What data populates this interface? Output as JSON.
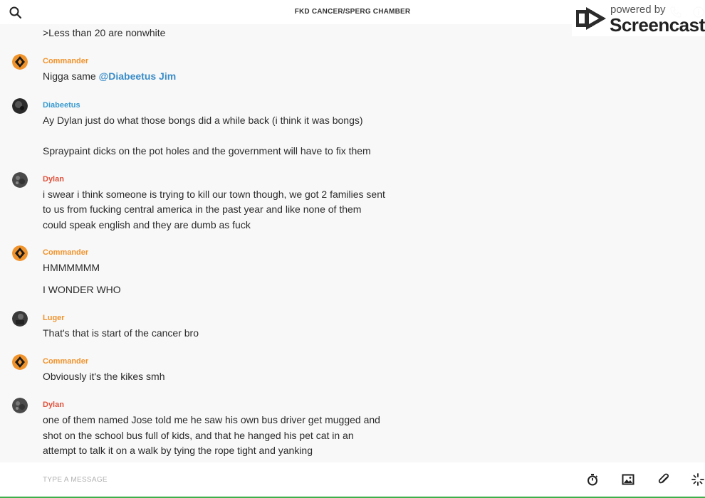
{
  "header": {
    "title": "FKD CANCER/SPERG CHAMBER",
    "search_icon": "search-icon",
    "right_icons": [
      "phone-icon",
      "info-icon"
    ]
  },
  "watermark": {
    "powered_by": "powered by",
    "brand": "Screencastify"
  },
  "colors": {
    "commander": "#f0932b",
    "diabeetus": "#3a9bd0",
    "dylan": "#e0523c",
    "luger": "#f0932b",
    "mention": "#3a8cc8",
    "composer_bar": "#3db04c"
  },
  "messages": [
    {
      "author": "",
      "lines": [
        ">Less than 20 are nonwhite"
      ]
    },
    {
      "author": "Commander",
      "lines": [
        "Nigga same "
      ],
      "mention": "@Diabeetus Jim"
    },
    {
      "author": "Diabeetus",
      "lines": [
        "Ay Dylan just do what those bongs did a while back (i think it was bongs)",
        "Spraypaint dicks on the pot holes and the government will have to fix them"
      ]
    },
    {
      "author": "Dylan",
      "lines": [
        "i swear i think someone is trying to kill our town though, we got 2 families sent",
        "to us from fucking central america in the past year and like none of them",
        "could speak english and they are dumb as fuck"
      ]
    },
    {
      "author": "Commander",
      "lines": [
        "HMMMMMM",
        "I WONDER WHO"
      ]
    },
    {
      "author": "Luger",
      "lines": [
        "That's that is start of the cancer bro"
      ]
    },
    {
      "author": "Commander",
      "lines": [
        "Obviously it's the kikes smh"
      ]
    },
    {
      "author": "Dylan",
      "lines": [
        "one of them named Jose told me he saw his own bus driver get mugged and",
        "shot on the school bus full of kids, and that he hanged his pet cat in an",
        "attempt to talk it on a walk by tying the rope tight and yanking"
      ]
    }
  ],
  "composer": {
    "placeholder": "TYPE A MESSAGE",
    "tools": [
      "timer-icon",
      "image-icon",
      "attachment-icon",
      "sparkle-icon"
    ]
  }
}
